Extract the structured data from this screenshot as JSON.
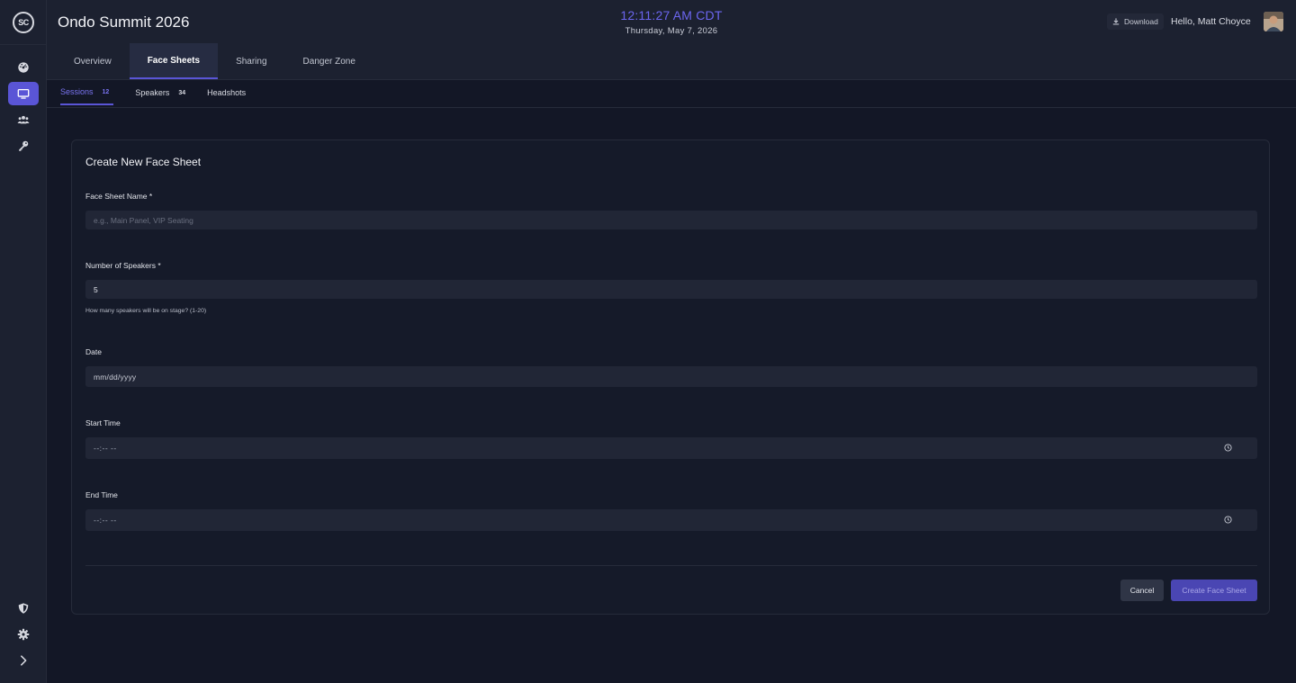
{
  "sidebar": {
    "logo": "SC",
    "items": [
      {
        "icon": "dashboard-icon"
      },
      {
        "icon": "monitor-icon",
        "active": true
      },
      {
        "icon": "users-icon"
      },
      {
        "icon": "key-icon"
      }
    ],
    "bottom": [
      {
        "icon": "shield-icon"
      },
      {
        "icon": "gear-icon"
      },
      {
        "icon": "chevron-right-icon"
      }
    ]
  },
  "header": {
    "event_title": "Ondo Summit 2026",
    "clock_time": "12:11:27 AM CDT",
    "clock_date": "Thursday, May 7, 2026",
    "download_label": "Download",
    "greeting": "Hello, Matt Choyce"
  },
  "tabs": [
    {
      "label": "Overview"
    },
    {
      "label": "Face Sheets",
      "active": true
    },
    {
      "label": "Sharing"
    },
    {
      "label": "Danger Zone"
    }
  ],
  "subtabs": [
    {
      "label": "Sessions",
      "count": "12",
      "active": true
    },
    {
      "label": "Speakers",
      "count": "34"
    },
    {
      "label": "Headshots"
    }
  ],
  "form": {
    "title": "Create New Face Sheet",
    "name_label": "Face Sheet Name *",
    "name_placeholder": "e.g., Main Panel, VIP Seating",
    "speakers_label": "Number of Speakers *",
    "speakers_value": "5",
    "speakers_hint": "How many speakers will be on stage? (1-20)",
    "date_label": "Date",
    "date_value": "mm/dd/yyyy",
    "start_label": "Start Time",
    "start_value": "--:-- --",
    "end_label": "End Time",
    "end_value": "--:-- --",
    "cancel_label": "Cancel",
    "create_label": "Create Face Sheet"
  },
  "colors": {
    "accent": "#5a55d6",
    "background": "#131726",
    "panel": "#1c2130"
  }
}
